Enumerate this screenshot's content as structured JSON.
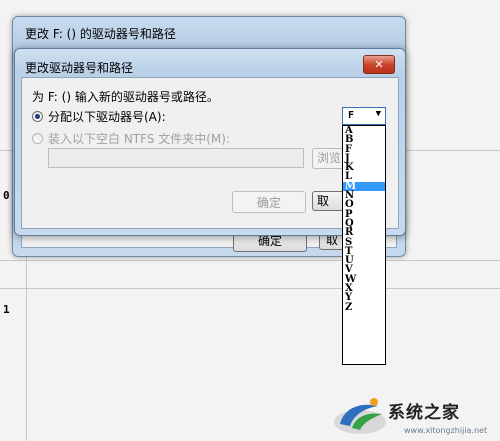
{
  "background": {
    "row_labels": [
      "0",
      "1"
    ]
  },
  "outer_dialog": {
    "title": "更改 F: () 的驱动器号和路径",
    "ok_label": "确定",
    "cancel_label": "取"
  },
  "inner_dialog": {
    "title": "更改驱动器号和路径",
    "close_label": "✕",
    "prompt": "为 F: () 输入新的驱动器号或路径。",
    "option_assign": "分配以下驱动器号(A):",
    "option_mount": "装入以下空白 NTFS 文件夹中(M):",
    "path_value": "",
    "browse_label": "浏览",
    "ok_label": "确定",
    "cancel_label": "取"
  },
  "drive_combo": {
    "selected": "F",
    "arrow": "▼",
    "options": [
      "A",
      "B",
      "F",
      "J",
      "K",
      "L",
      "M",
      "N",
      "O",
      "P",
      "Q",
      "R",
      "S",
      "T",
      "U",
      "V",
      "W",
      "X",
      "Y",
      "Z"
    ],
    "highlighted": "M"
  },
  "watermark": {
    "text": "系统之家",
    "url": "www.xitongzhijia.net"
  },
  "colors": {
    "highlight": "#3399ff",
    "close_red": "#c9452c"
  }
}
